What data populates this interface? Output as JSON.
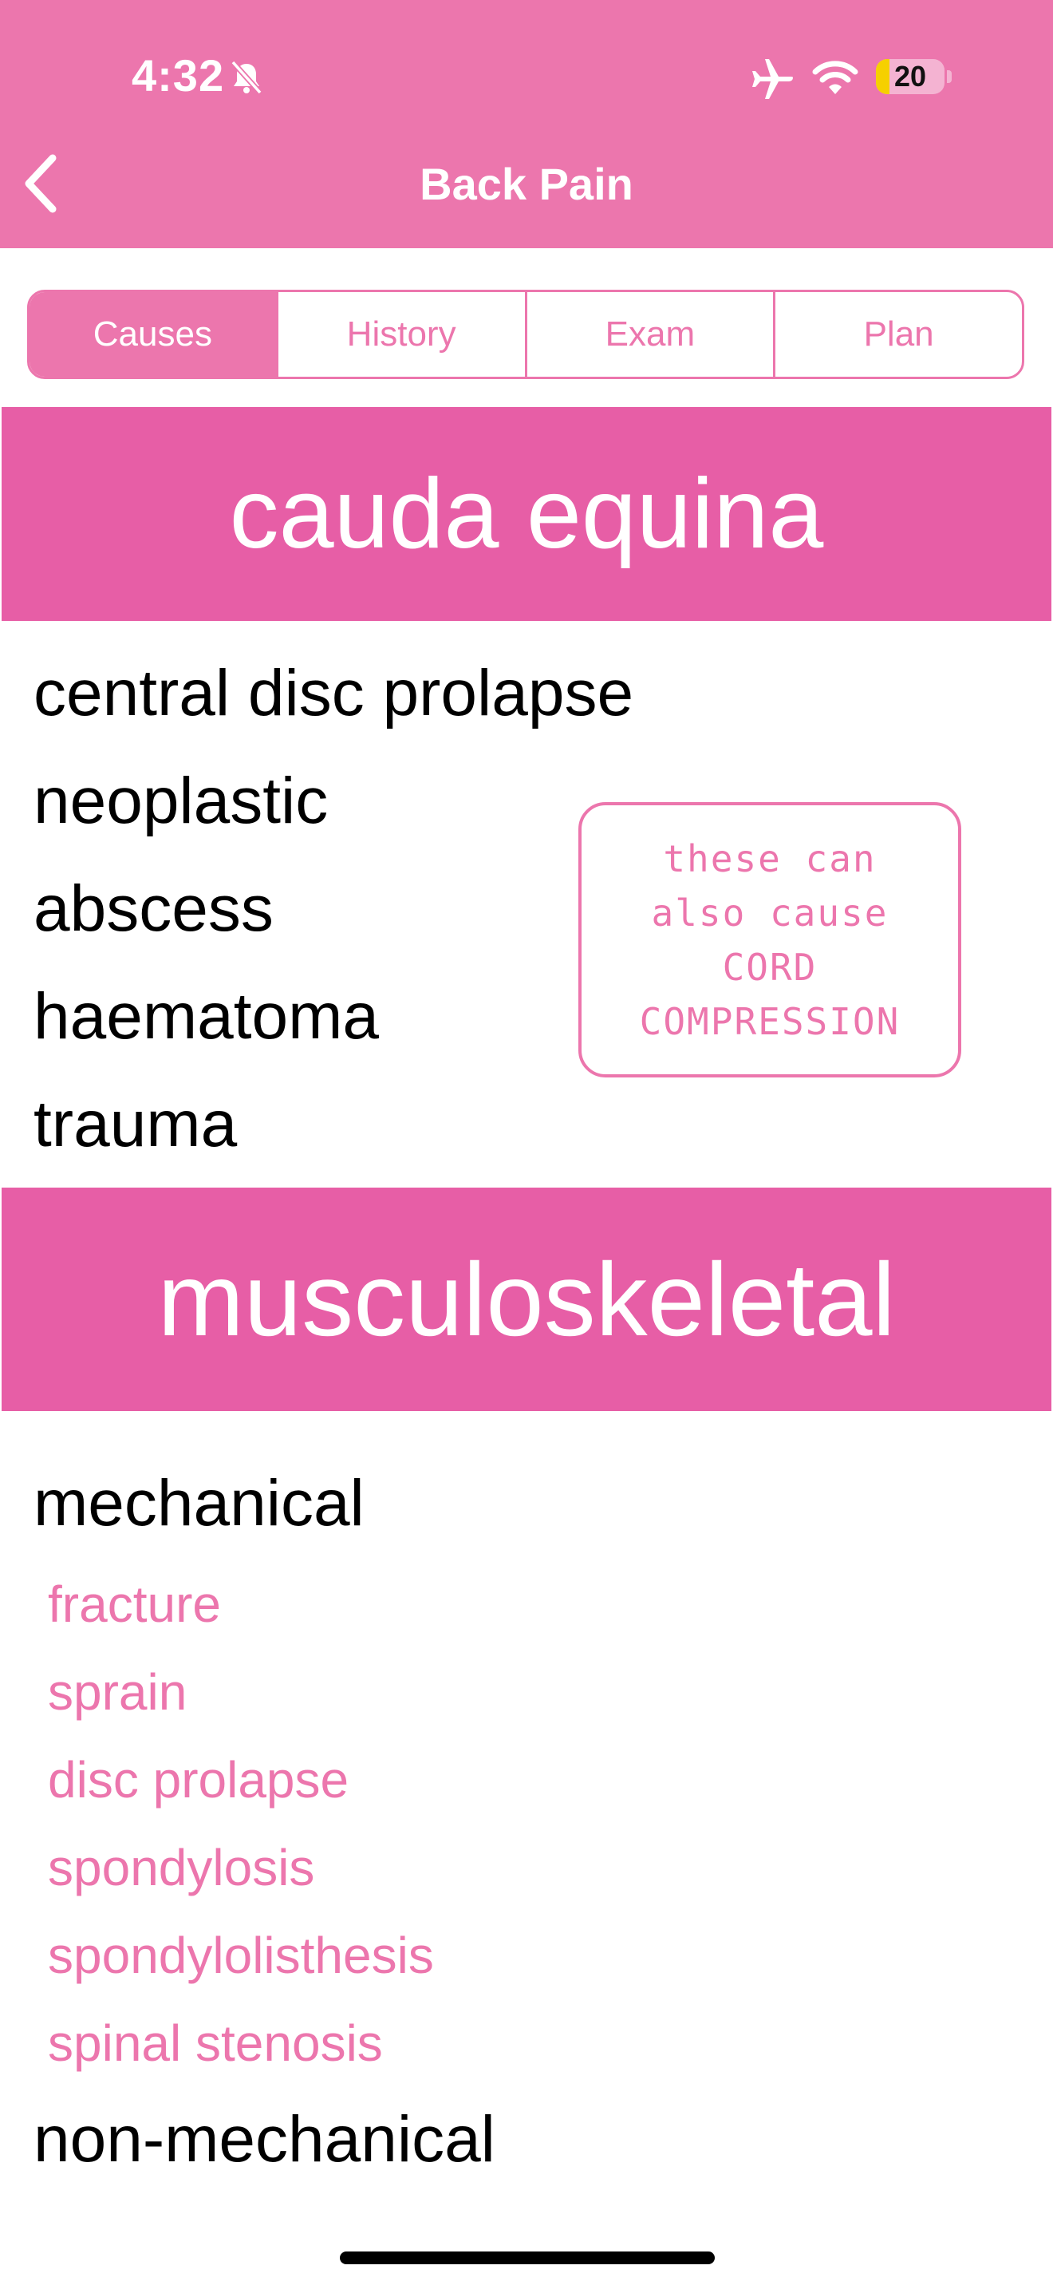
{
  "status_bar": {
    "time": "4:32",
    "battery_level": "20",
    "battery_fraction": 0.2,
    "icons": [
      "bell-slash-icon",
      "airplane-icon",
      "wifi-icon",
      "battery-icon"
    ]
  },
  "nav": {
    "back_icon": "chevron-left-icon",
    "title": "Back Pain"
  },
  "tabs": [
    {
      "label": "Causes",
      "active": true
    },
    {
      "label": "History",
      "active": false
    },
    {
      "label": "Exam",
      "active": false
    },
    {
      "label": "Plan",
      "active": false
    }
  ],
  "sections": {
    "cauda_equina": {
      "title": "cauda equina",
      "items": [
        "central disc prolapse",
        "neoplastic",
        "abscess",
        "haematoma",
        "trauma"
      ],
      "note": [
        "these can",
        "also cause",
        "CORD",
        "COMPRESSION"
      ]
    },
    "musculoskeletal": {
      "title": "musculoskeletal",
      "mechanical": {
        "label": "mechanical",
        "items": [
          "fracture",
          "sprain",
          "disc prolapse",
          "spondylosis",
          "spondylolisthesis",
          "spinal stenosis"
        ]
      },
      "non_mechanical": {
        "label": "non-mechanical"
      }
    }
  },
  "colors": {
    "header": "#ec76ad",
    "banner": "#e75ea6",
    "accent": "#ec76ad"
  }
}
